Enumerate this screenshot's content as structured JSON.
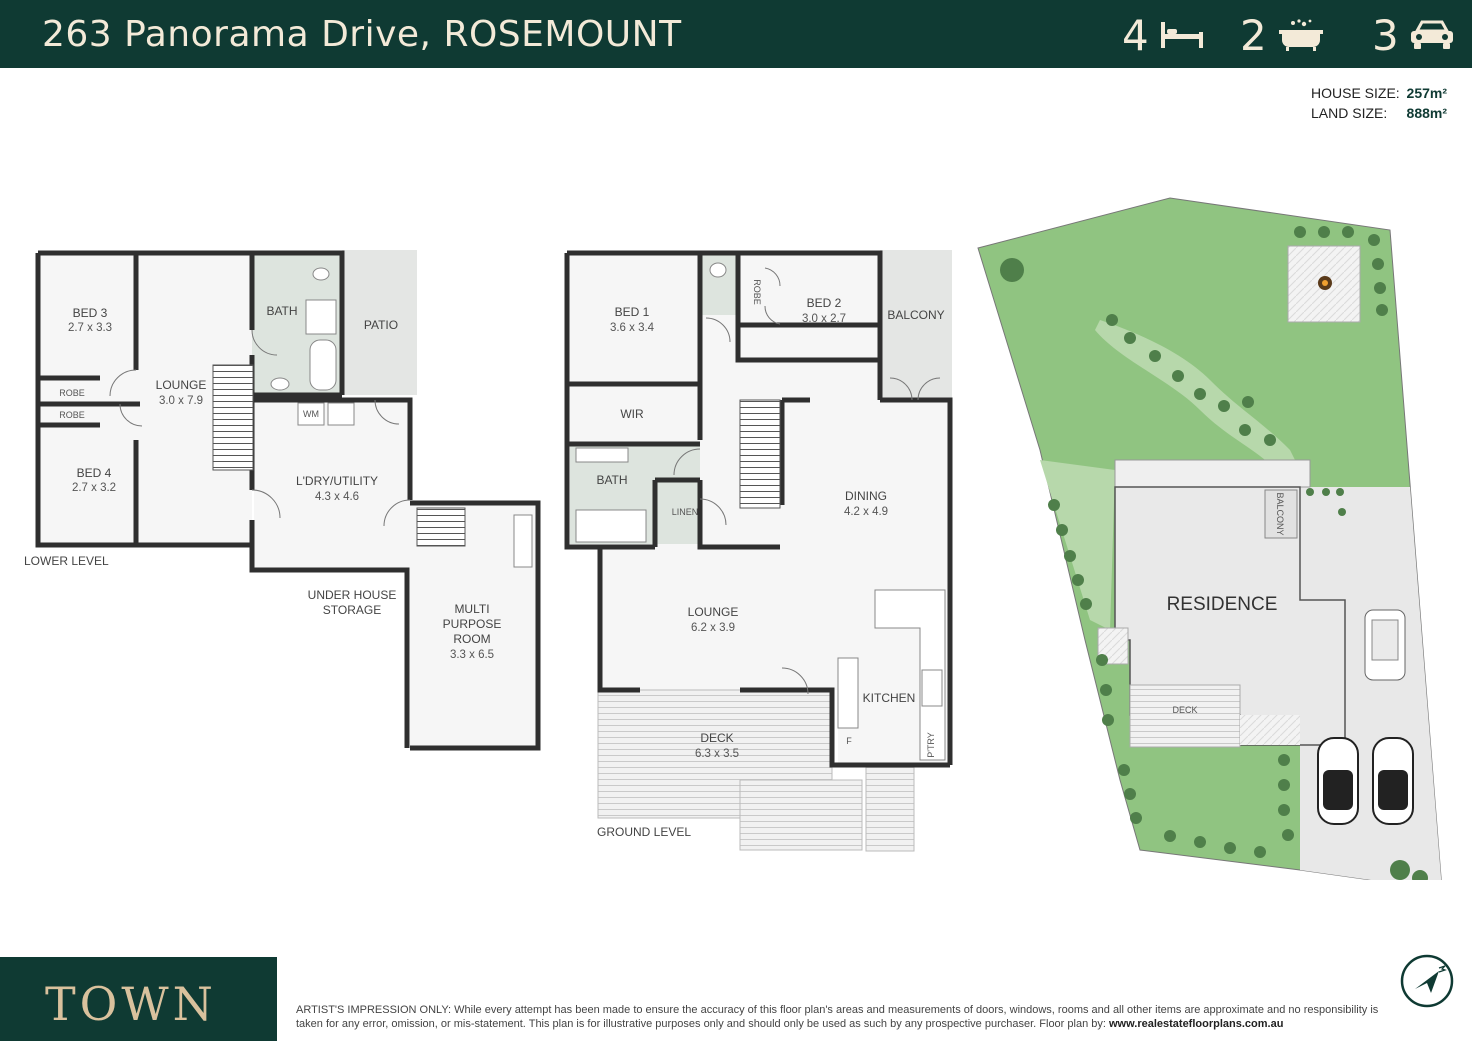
{
  "header": {
    "address": "263 Panorama Drive, ROSEMOUNT",
    "bedrooms": "4",
    "bathrooms": "2",
    "car_spaces": "3"
  },
  "sizes": {
    "house_label": "HOUSE SIZE:",
    "house_value": "257m²",
    "land_label": "LAND SIZE:",
    "land_value": "888m²"
  },
  "lower_level": {
    "level_label": "LOWER LEVEL",
    "bed3": {
      "name": "BED 3",
      "dim": "2.7 x 3.3"
    },
    "bed4": {
      "name": "BED 4",
      "dim": "2.7 x 3.2"
    },
    "robe1": "ROBE",
    "robe2": "ROBE",
    "lounge": {
      "name": "LOUNGE",
      "dim": "3.0 x 7.9"
    },
    "bath": "BATH",
    "patio": "PATIO",
    "wm": "WM",
    "laundry": {
      "name": "L'DRY/UTILITY",
      "dim": "4.3 x 4.6"
    },
    "storage": [
      "UNDER HOUSE",
      "STORAGE"
    ],
    "multi": {
      "name": [
        "MULTI",
        "PURPOSE",
        "ROOM"
      ],
      "dim": "3.3 x 6.5"
    }
  },
  "ground_level": {
    "level_label": "GROUND LEVEL",
    "bed1": {
      "name": "BED 1",
      "dim": "3.6 x 3.4"
    },
    "bed2": {
      "name": "BED 2",
      "dim": "3.0 x 2.7"
    },
    "robe": "ROBE",
    "balcony": "BALCONY",
    "wir": "WIR",
    "bath": "BATH",
    "linen": "LINEN",
    "dining": {
      "name": "DINING",
      "dim": "4.2 x 4.9"
    },
    "lounge": {
      "name": "LOUNGE",
      "dim": "6.2 x 3.9"
    },
    "kitchen": "KITCHEN",
    "fridge": "F",
    "pantry": "P'TRY",
    "deck": {
      "name": "DECK",
      "dim": "6.3 x 3.5"
    }
  },
  "site": {
    "residence": "RESIDENCE",
    "deck": "DECK",
    "balcony": "BALCONY"
  },
  "footer": {
    "brand": "TOWN",
    "disclaimer": "ARTIST'S IMPRESSION ONLY: While every attempt has been made to ensure the accuracy of this floor plan's areas and measurements of doors, windows, rooms and all other items are approximate and no responsibility is taken for any error, omission, or mis-statement. This plan is for illustrative purposes only and should only be used as such by any prospective purchaser. Floor plan by:",
    "website": "www.realestatefloorplans.com.au"
  },
  "colors": {
    "brand_green": "#0f3a33",
    "cream": "#f3ead8",
    "gold": "#d9c19d",
    "wall": "#2f2f2f",
    "wet_area": "#dde4de",
    "lawn": "#90c481",
    "tree": "#4f7f4a"
  }
}
